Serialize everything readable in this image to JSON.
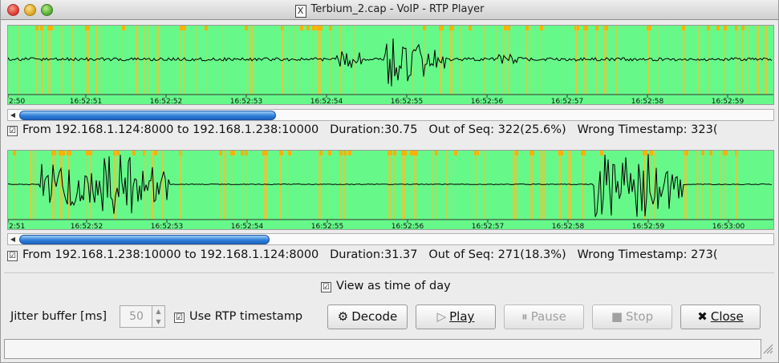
{
  "window": {
    "title": "Terbium_2.cap - VoIP - RTP Player"
  },
  "streams": [
    {
      "ticks": [
        "2:50",
        "16:52:51",
        "16:52:52",
        "16:52:53",
        "16:52:54",
        "16:52:55",
        "16:52:56",
        "16:52:57",
        "16:52:58",
        "16:52:59"
      ],
      "selected": true,
      "from": "From 192.168.1.124:8000 to 192.168.1.238:10000",
      "duration": "Duration:30.75",
      "out_of_seq": "Out of Seq: 322(25.6%)",
      "wrong_ts": "Wrong Timestamp: 323("
    },
    {
      "ticks": [
        "2:51",
        "16:52:52",
        "16:52:53",
        "16:52:54",
        "16:52:55",
        "16:52:56",
        "16:52:57",
        "16:52:58",
        "16:52:59",
        "16:53:00"
      ],
      "selected": true,
      "from": "From 192.168.1.238:10000 to 192.168.1.124:8000",
      "duration": "Duration:31.37",
      "out_of_seq": "Out of Seq: 271(18.3%)",
      "wrong_ts": "Wrong Timestamp: 273("
    }
  ],
  "controls": {
    "view_time_of_day": "View as time of day",
    "jitter_label": "Jitter buffer [ms]",
    "jitter_value": "50",
    "use_rtp_ts": "Use RTP timestamp",
    "decode": "Decode",
    "play": "Play",
    "pause": "Pause",
    "stop": "Stop",
    "close": "Close"
  },
  "colors": {
    "wave_bg": "#66f98a",
    "marker": "#e2c93a",
    "marker_top": "#ffb000"
  }
}
